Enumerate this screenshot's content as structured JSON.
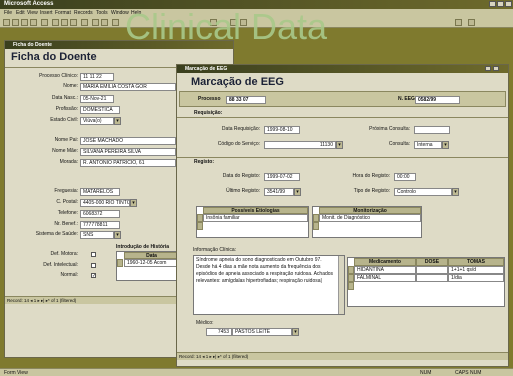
{
  "app_title": "Microsoft Access",
  "watermark": "Clinical Data",
  "menu": [
    "File",
    "Edit",
    "View",
    "Insert",
    "Format",
    "Records",
    "Tools",
    "Window",
    "Help"
  ],
  "status": {
    "left": "Form View",
    "right": [
      "NUM",
      "CAPS NUM"
    ]
  },
  "form1": {
    "window_title": "Ficha do Doente",
    "heading": "Ficha do Doente",
    "labels": [
      "Processo Clínico:",
      "Nome:",
      "Data Nasc.:",
      "Profissão:",
      "Estado Civil:",
      "Nome Pai:",
      "Nome Mãe:",
      "Morada:",
      "Freguesia:",
      "C. Postal:",
      "Telefone:",
      "Nr. Benef.:",
      "Sistema de Saúde:"
    ],
    "values": [
      "11 11 22",
      "MARIA EMILIA COSTA GOR",
      "05-Nov-21",
      "DOMESTICA",
      "Viúva(o)",
      "JOSÉ MACHADO",
      "SILVANA PEREIRA SILVA",
      "R. ANTÓNIO PATRÍCIO, 61",
      "MATARELOS",
      "4405-000 RIO TINTO",
      "6068372",
      "777778811",
      "SNS"
    ],
    "checks": [
      "Def. Motora:",
      "Def. Intelectual:",
      "Normal:"
    ],
    "hist_title": "Introdução de História",
    "hist_col": "Data",
    "hist_row": "1960-12-05 Acom",
    "nav": "Record: 14 ◂ 1 ▸ ▸| ▸* of 1 (filtered)"
  },
  "form2": {
    "window_title": "Marcação de EEG",
    "heading": "Marcação de EEG",
    "processo_label": "Processo",
    "processo_value": "88 33 07",
    "eeg_label": "N. EEG:",
    "eeg_value": "0582/99",
    "req_section": "Requisição:",
    "data_req_label": "Data Requisição:",
    "data_req_value": "1999-08-10",
    "prox_consulta_label": "Próxima Consulta:",
    "cod_servico_label": "Código do Serviço:",
    "cod_servico_value": "11130",
    "consulta_label": "Consulta:",
    "consulta_value": "Interna",
    "reg_section": "Registo:",
    "data_reg_label": "Data do Registo:",
    "data_reg_value": "1999-07-02",
    "hora_reg_label": "Hora do Registo:",
    "hora_reg_value": "00:00",
    "ult_reg_label": "Último Registo:",
    "ult_reg_value": "3541/99",
    "tipo_reg_label": "Tipo de Registo:",
    "tipo_reg_value": "Controlo",
    "etiologias_header": "Possíveis Etiologias",
    "etiologias_row": "Insônia familiar",
    "monit_header": "Monitorização",
    "monit_row": "Monit. de Diagnóstico",
    "info_label": "Informação Clínica:",
    "info_text": "Síndrome apneia do sono diagnosticado em Outubro 97. Desde há 4 dias a mãe nota aumento da frequência dos episódios de apneia associado a respiração ruidosa. Achados relevantes: amígdalas hipertrofiadas; respiração ruidosa|",
    "med_headers": [
      "Medicamento",
      "DOSE",
      "TOMAS"
    ],
    "med_rows": [
      [
        "HIDANTINA",
        "",
        "1+1+1 qs/d"
      ],
      [
        "FALMINAL",
        "",
        "1/dia"
      ]
    ],
    "medico_label": "Médico:",
    "medico_code": "7453",
    "medico_name": "PASTOS LEITE",
    "nav": "Record: 14 ◂ 1 ▸ ▸| ▸* of 1 (filtered)"
  }
}
